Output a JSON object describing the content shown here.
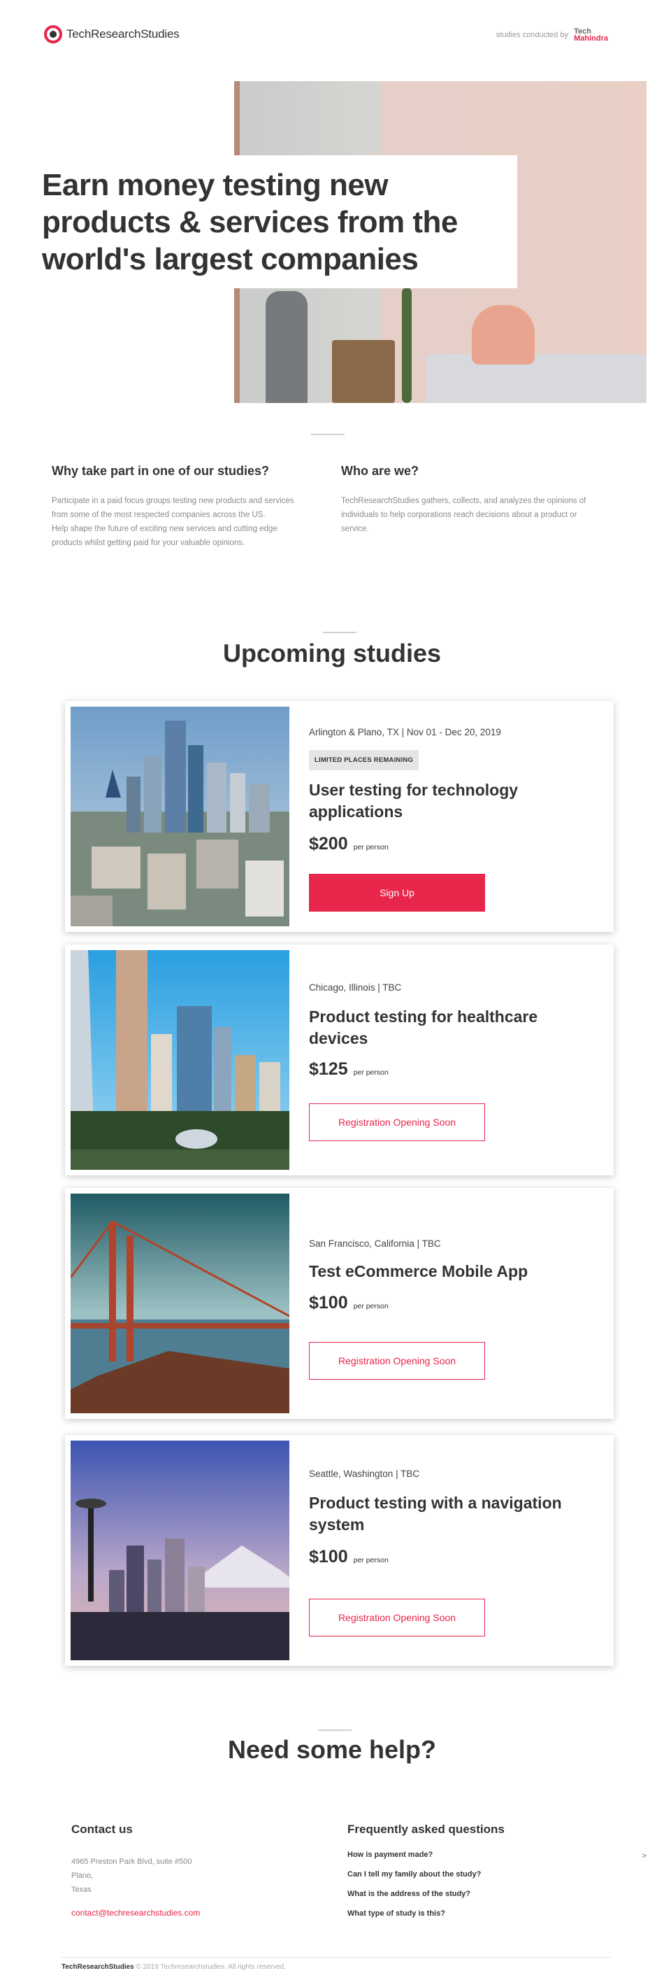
{
  "header": {
    "brand": "TechResearchStudies",
    "conducted_by": "studies conducted by",
    "partner_line1": "Tech",
    "partner_line2": "Mahindra"
  },
  "hero": {
    "title_line1": "Earn money testing new",
    "title_line2": "products & services from the",
    "title_line3": "world's largest companies"
  },
  "intro": {
    "why_heading": "Why take part in one of our studies?",
    "why_text_1": "Participate in a paid focus groups testing new products and services from some of the most respected companies across the US.",
    "why_text_2": "Help shape the future of exciting new services and cutting edge products whilst getting paid for your valuable opinions.",
    "who_heading": "Who are we?",
    "who_text": "TechResearchStudies gathers, collects, and analyzes the opinions of individuals to help corporations reach decisions about a product or service."
  },
  "studies": {
    "heading": "Upcoming studies",
    "items": [
      {
        "location": "Arlington & Plano, TX | Nov 01 - Dec 20, 2019",
        "badge": "LIMITED PLACES REMAINING",
        "title_line1": "User testing for technology",
        "title_line2": "applications",
        "price": "$200",
        "per": "per person",
        "button": "Sign Up"
      },
      {
        "location": "Chicago, Illinois | TBC",
        "title_line1": "Product testing for healthcare",
        "title_line2": "devices",
        "price": "$125",
        "per": "per person",
        "button": "Registration Opening Soon"
      },
      {
        "location": "San Francisco, California | TBC",
        "title_line1": "Test eCommerce Mobile App",
        "price": "$100",
        "per": "per person",
        "button": "Registration Opening Soon"
      },
      {
        "location": "Seattle, Washington | TBC",
        "title_line1": "Product testing with a navigation",
        "title_line2": "system",
        "price": "$100",
        "per": "per person",
        "button": "Registration Opening Soon"
      }
    ]
  },
  "help": {
    "heading": "Need some help?",
    "contact_heading": "Contact us",
    "address_line1": "4965 Preston Park Blvd, suite #500",
    "address_line2": "Plano,",
    "address_line3": "Texas",
    "email": "contact@techresearchstudies.com",
    "faq_heading": "Frequently asked questions",
    "faqs": [
      "How is payment made?",
      "Can I tell my family about the study?",
      "What is the address of the study?",
      "What type of study is this?"
    ],
    "chevron": ">"
  },
  "footer": {
    "brand": "TechResearchStudies",
    "copyright": "© 2019 Techresearchstudies. All rights reserved."
  },
  "colors": {
    "accent": "#e8254a",
    "text": "#333333",
    "muted": "#8a8a8a"
  }
}
